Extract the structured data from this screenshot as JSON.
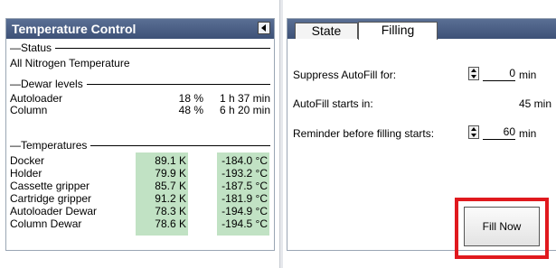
{
  "left": {
    "title": "Temperature Control",
    "status_heading": "Status",
    "status_text": "All Nitrogen Temperature",
    "dewar_heading": "Dewar levels",
    "dewar": [
      {
        "name": "Autoloader",
        "pct": "18 %",
        "time": "1 h 37 min"
      },
      {
        "name": "Column",
        "pct": "48 %",
        "time": "6 h 20 min"
      }
    ],
    "temps_heading": "Temperatures",
    "temps": [
      {
        "name": "Docker",
        "k": "89.1 K",
        "c": "-184.0 °C"
      },
      {
        "name": "Holder",
        "k": "79.9 K",
        "c": "-193.2 °C"
      },
      {
        "name": "Cassette gripper",
        "k": "85.7 K",
        "c": "-187.5 °C"
      },
      {
        "name": "Cartridge gripper",
        "k": "91.2 K",
        "c": "-181.9 °C"
      },
      {
        "name": "Autoloader Dewar",
        "k": "78.3 K",
        "c": "-194.9 °C"
      },
      {
        "name": "Column Dewar",
        "k": "78.6 K",
        "c": "-194.5 °C"
      }
    ],
    "highlight_color": "#c1e2c4"
  },
  "right": {
    "tabs": [
      "State",
      "Filling"
    ],
    "active_tab": "Filling",
    "suppress_label": "Suppress AutoFill for:",
    "suppress_value": "0",
    "suppress_unit": "min",
    "autofill_label": "AutoFill starts in:",
    "autofill_value": "45 min",
    "reminder_label": "Reminder before filling starts:",
    "reminder_value": "60",
    "reminder_unit": "min",
    "fill_button": "Fill Now",
    "highlight_box_color": "#e0191e"
  }
}
